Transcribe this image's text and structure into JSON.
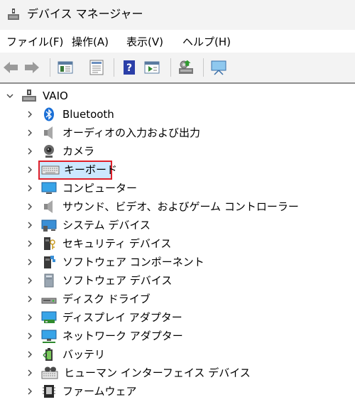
{
  "window": {
    "title": "デバイス マネージャー",
    "accent": "#e0202a",
    "selection": "#cce8ff"
  },
  "menu": [
    "ファイル(F)",
    "操作(A)",
    "表示(V)",
    "ヘルプ(H)"
  ],
  "toolbar": [
    "back-icon",
    "forward-icon",
    "properties-icon",
    "update-driver-icon",
    "help-icon",
    "run-icon",
    "scan-hardware-icon",
    "monitor-icon"
  ],
  "tree": {
    "root": "VAIO",
    "items": [
      {
        "label": "Bluetooth",
        "icon": "bluetooth-icon"
      },
      {
        "label": "オーディオの入力および出力",
        "icon": "speaker-icon"
      },
      {
        "label": "カメラ",
        "icon": "camera-icon"
      },
      {
        "label": "キーボード",
        "icon": "keyboard-icon",
        "selected": true
      },
      {
        "label": "コンピューター",
        "icon": "computer-icon"
      },
      {
        "label": "サウンド、ビデオ、およびゲーム コントローラー",
        "icon": "speaker-icon"
      },
      {
        "label": "システム デバイス",
        "icon": "system-device-icon"
      },
      {
        "label": "セキュリティ デバイス",
        "icon": "security-device-icon"
      },
      {
        "label": "ソフトウェア コンポーネント",
        "icon": "software-component-icon"
      },
      {
        "label": "ソフトウェア デバイス",
        "icon": "software-device-icon"
      },
      {
        "label": "ディスク ドライブ",
        "icon": "disk-drive-icon"
      },
      {
        "label": "ディスプレイ アダプター",
        "icon": "display-adapter-icon"
      },
      {
        "label": "ネットワーク アダプター",
        "icon": "network-adapter-icon"
      },
      {
        "label": "バッテリ",
        "icon": "battery-icon"
      },
      {
        "label": "ヒューマン インターフェイス デバイス",
        "icon": "hid-icon"
      },
      {
        "label": "ファームウェア",
        "icon": "firmware-icon"
      }
    ]
  }
}
